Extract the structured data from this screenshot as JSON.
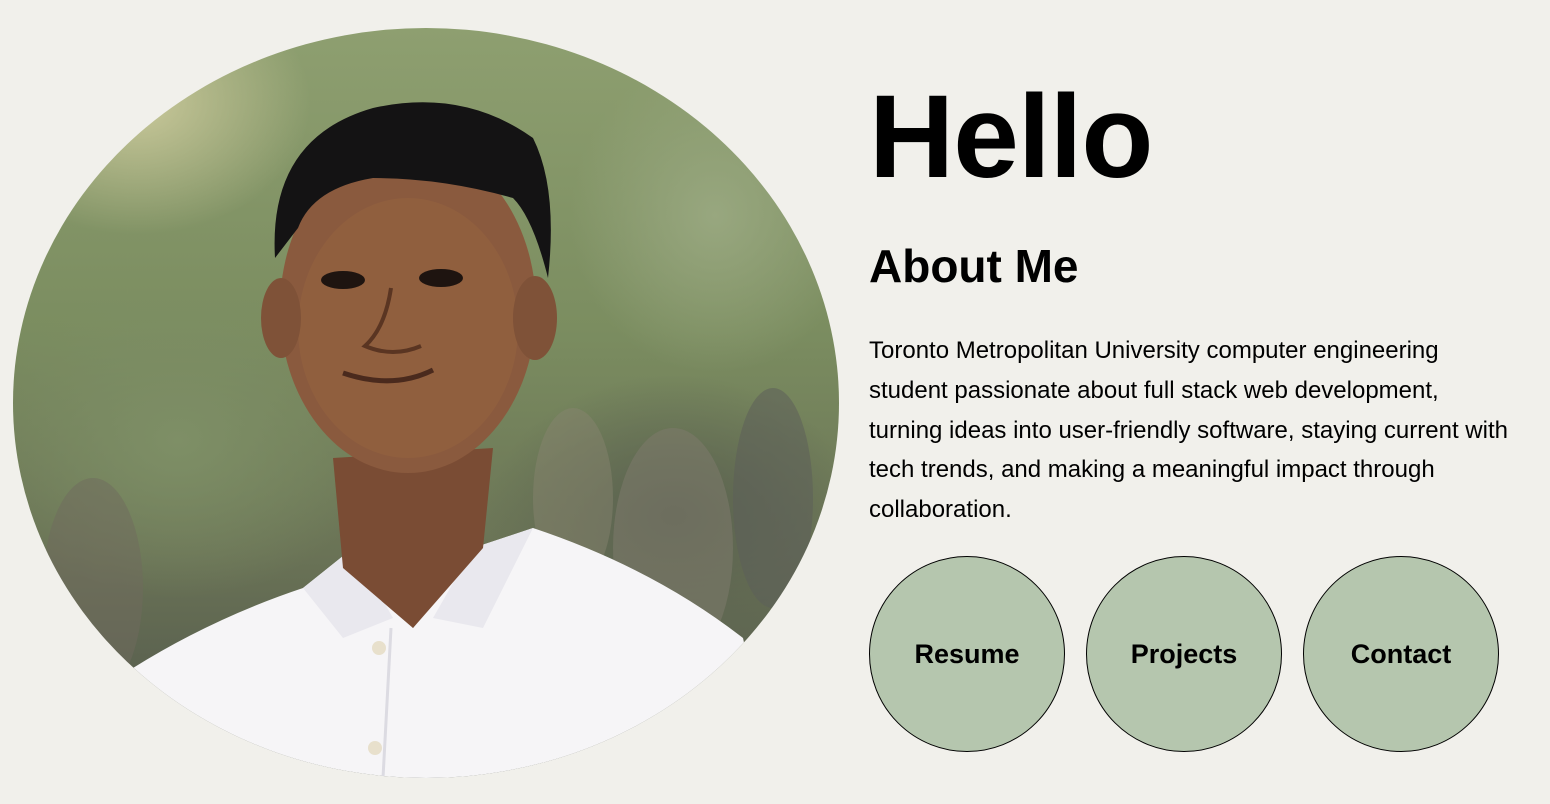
{
  "hero": {
    "greeting": "Hello",
    "portrait": "profile-photo"
  },
  "about": {
    "title": "About Me",
    "text": "Toronto Metropolitan University computer engineering student passionate about full stack web development, turning ideas into user-friendly software, staying current with tech trends, and making a meaningful impact through collaboration."
  },
  "nav": {
    "buttons": [
      {
        "label": "Resume"
      },
      {
        "label": "Projects"
      },
      {
        "label": "Contact"
      }
    ]
  },
  "colors": {
    "background": "#f1f0eb",
    "button_fill": "#b5c6ae",
    "text": "#000000"
  }
}
